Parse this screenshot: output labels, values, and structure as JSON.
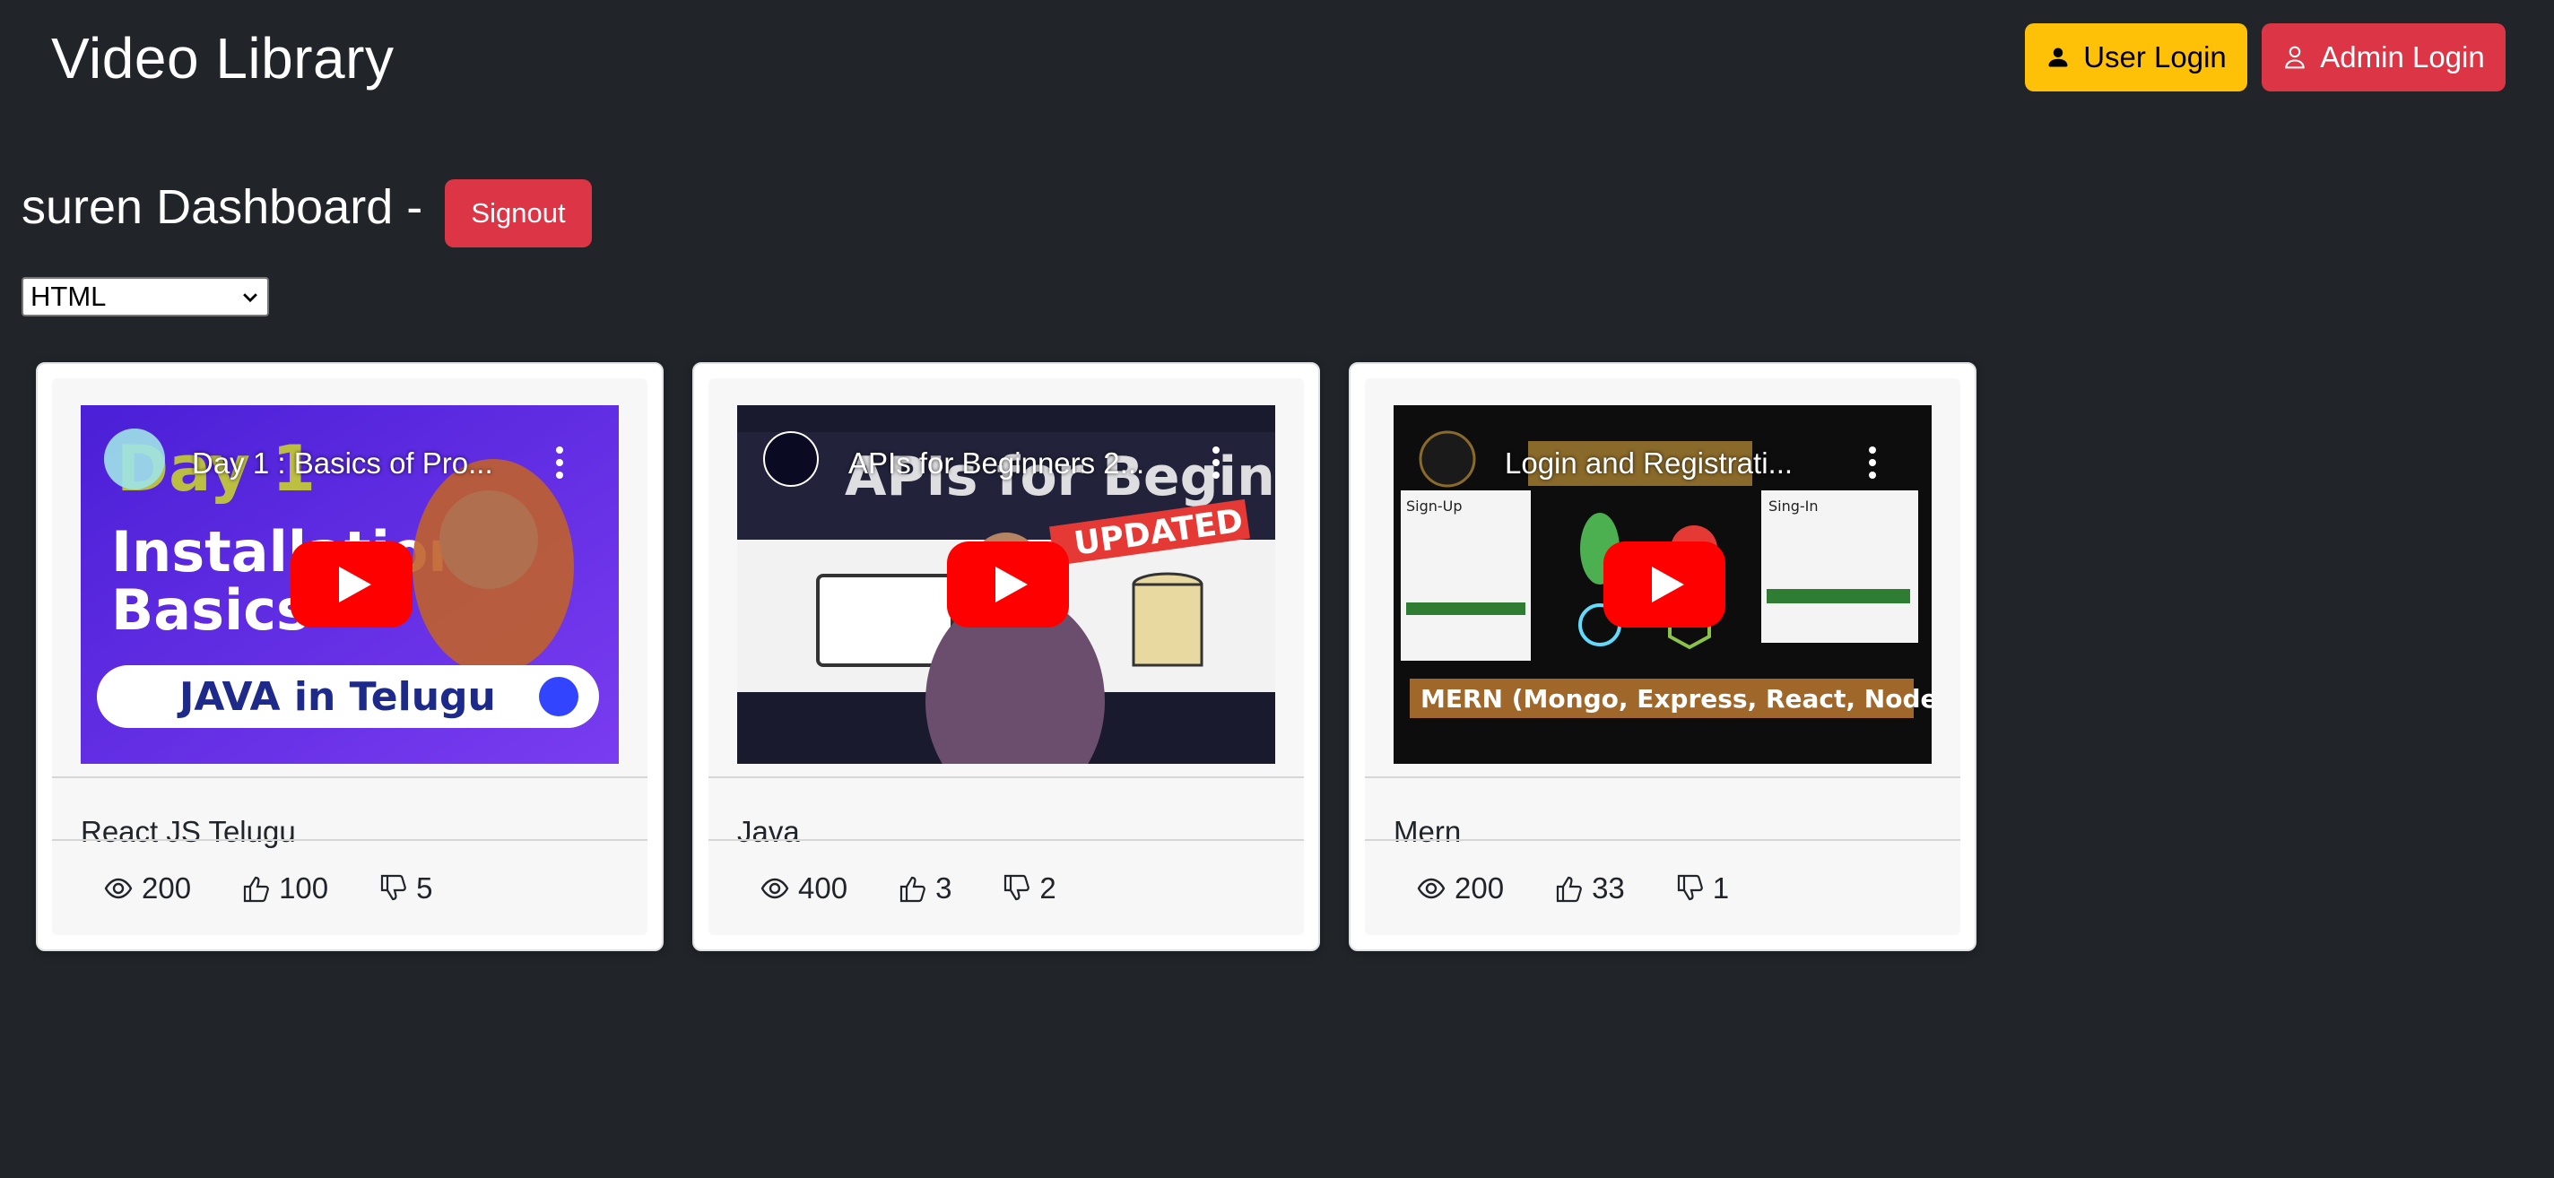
{
  "header": {
    "title": "Video Library",
    "user_login_label": "User Login",
    "admin_login_label": "Admin Login"
  },
  "dashboard": {
    "title": "suren Dashboard -",
    "signout_label": "Signout",
    "category_select": {
      "selected": "HTML"
    }
  },
  "colors": {
    "background": "#212529",
    "warning": "#ffc107",
    "danger": "#dc3545",
    "youtube_red": "#ff0000"
  },
  "videos": [
    {
      "video_title": "Day 1 : Basics of Pro...",
      "thumbnail_text": [
        "Day 1",
        "Installation",
        "Basics",
        "JAVA in Telugu"
      ],
      "name": "React JS Telugu",
      "views": "200",
      "likes": "100",
      "dislikes": "5"
    },
    {
      "video_title": "APIs for Beginners 2...",
      "thumbnail_text": [
        "APIs for Beginners",
        "UPDATED"
      ],
      "name": "Java",
      "views": "400",
      "likes": "3",
      "dislikes": "2"
    },
    {
      "video_title": "Login and Registrati...",
      "thumbnail_text": [
        "Sign-Up",
        "Sing-In",
        "MERN (Mongo, Express, React, Node)"
      ],
      "name": "Mern",
      "views": "200",
      "likes": "33",
      "dislikes": "1"
    }
  ]
}
